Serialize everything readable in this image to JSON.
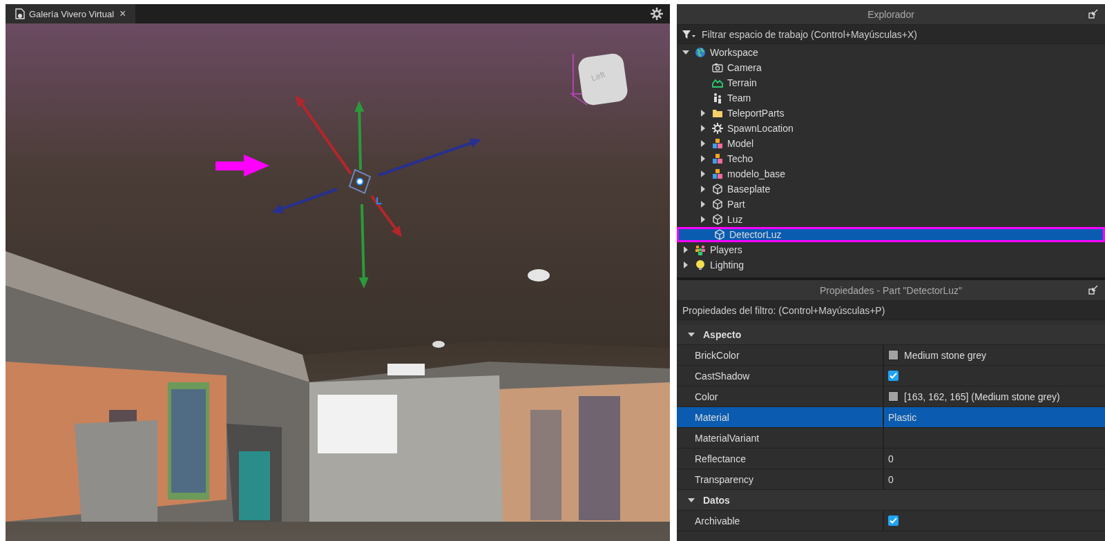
{
  "tab": {
    "title": "Galería Vivero Virtual",
    "close": "×"
  },
  "viewport": {
    "gizmo_label": "L",
    "view_cube_label": "Left"
  },
  "explorer": {
    "title": "Explorador",
    "filter_placeholder": "Filtrar espacio de trabajo (Control+Mayúsculas+X)",
    "items": [
      {
        "label": "Workspace",
        "kind": "globe",
        "has_children": true,
        "expanded": true,
        "selected": false,
        "annotated": false,
        "children": [
          {
            "label": "Camera",
            "kind": "camera",
            "has_children": false,
            "expanded": false,
            "selected": false,
            "annotated": false
          },
          {
            "label": "Terrain",
            "kind": "terrain",
            "has_children": false,
            "expanded": false,
            "selected": false,
            "annotated": false
          },
          {
            "label": "Team",
            "kind": "team",
            "has_children": false,
            "expanded": false,
            "selected": false,
            "annotated": false
          },
          {
            "label": "TeleportParts",
            "kind": "folder",
            "has_children": true,
            "expanded": false,
            "selected": false,
            "annotated": false
          },
          {
            "label": "SpawnLocation",
            "kind": "spawn",
            "has_children": true,
            "expanded": false,
            "selected": false,
            "annotated": false
          },
          {
            "label": "Model",
            "kind": "model",
            "has_children": true,
            "expanded": false,
            "selected": false,
            "annotated": false
          },
          {
            "label": "Techo",
            "kind": "model",
            "has_children": true,
            "expanded": false,
            "selected": false,
            "annotated": false
          },
          {
            "label": "modelo_base",
            "kind": "model",
            "has_children": true,
            "expanded": false,
            "selected": false,
            "annotated": false
          },
          {
            "label": "Baseplate",
            "kind": "part",
            "has_children": true,
            "expanded": false,
            "selected": false,
            "annotated": false
          },
          {
            "label": "Part",
            "kind": "part",
            "has_children": true,
            "expanded": false,
            "selected": false,
            "annotated": false
          },
          {
            "label": "Luz",
            "kind": "part",
            "has_children": true,
            "expanded": false,
            "selected": false,
            "annotated": false
          },
          {
            "label": "DetectorLuz",
            "kind": "part",
            "has_children": false,
            "expanded": false,
            "selected": true,
            "annotated": true
          }
        ]
      },
      {
        "label": "Players",
        "kind": "players",
        "has_children": true,
        "expanded": false,
        "selected": false,
        "annotated": false
      },
      {
        "label": "Lighting",
        "kind": "lighting",
        "has_children": true,
        "expanded": false,
        "selected": false,
        "annotated": false
      }
    ]
  },
  "properties": {
    "title": "Propiedades - Part \"DetectorLuz\"",
    "filter_placeholder": "Propiedades del filtro: (Control+Mayúsculas+P)",
    "sections": [
      {
        "name": "Aspecto",
        "expanded": true,
        "rows": [
          {
            "name": "BrickColor",
            "kind": "color",
            "value": "Medium stone grey",
            "color": "#a3a2a5",
            "selected": false
          },
          {
            "name": "CastShadow",
            "kind": "check",
            "checked": true,
            "selected": false
          },
          {
            "name": "Color",
            "kind": "color",
            "value": "[163, 162, 165] (Medium stone grey)",
            "color": "#a3a2a5",
            "selected": false
          },
          {
            "name": "Material",
            "kind": "text",
            "value": "Plastic",
            "selected": true
          },
          {
            "name": "MaterialVariant",
            "kind": "text",
            "selected": false
          },
          {
            "name": "Reflectance",
            "kind": "text",
            "value": "0",
            "selected": false
          },
          {
            "name": "Transparency",
            "kind": "text",
            "value": "0",
            "selected": false
          }
        ]
      },
      {
        "name": "Datos",
        "expanded": true,
        "rows": [
          {
            "name": "Archivable",
            "kind": "check",
            "checked": true,
            "selected": false
          }
        ]
      }
    ]
  }
}
